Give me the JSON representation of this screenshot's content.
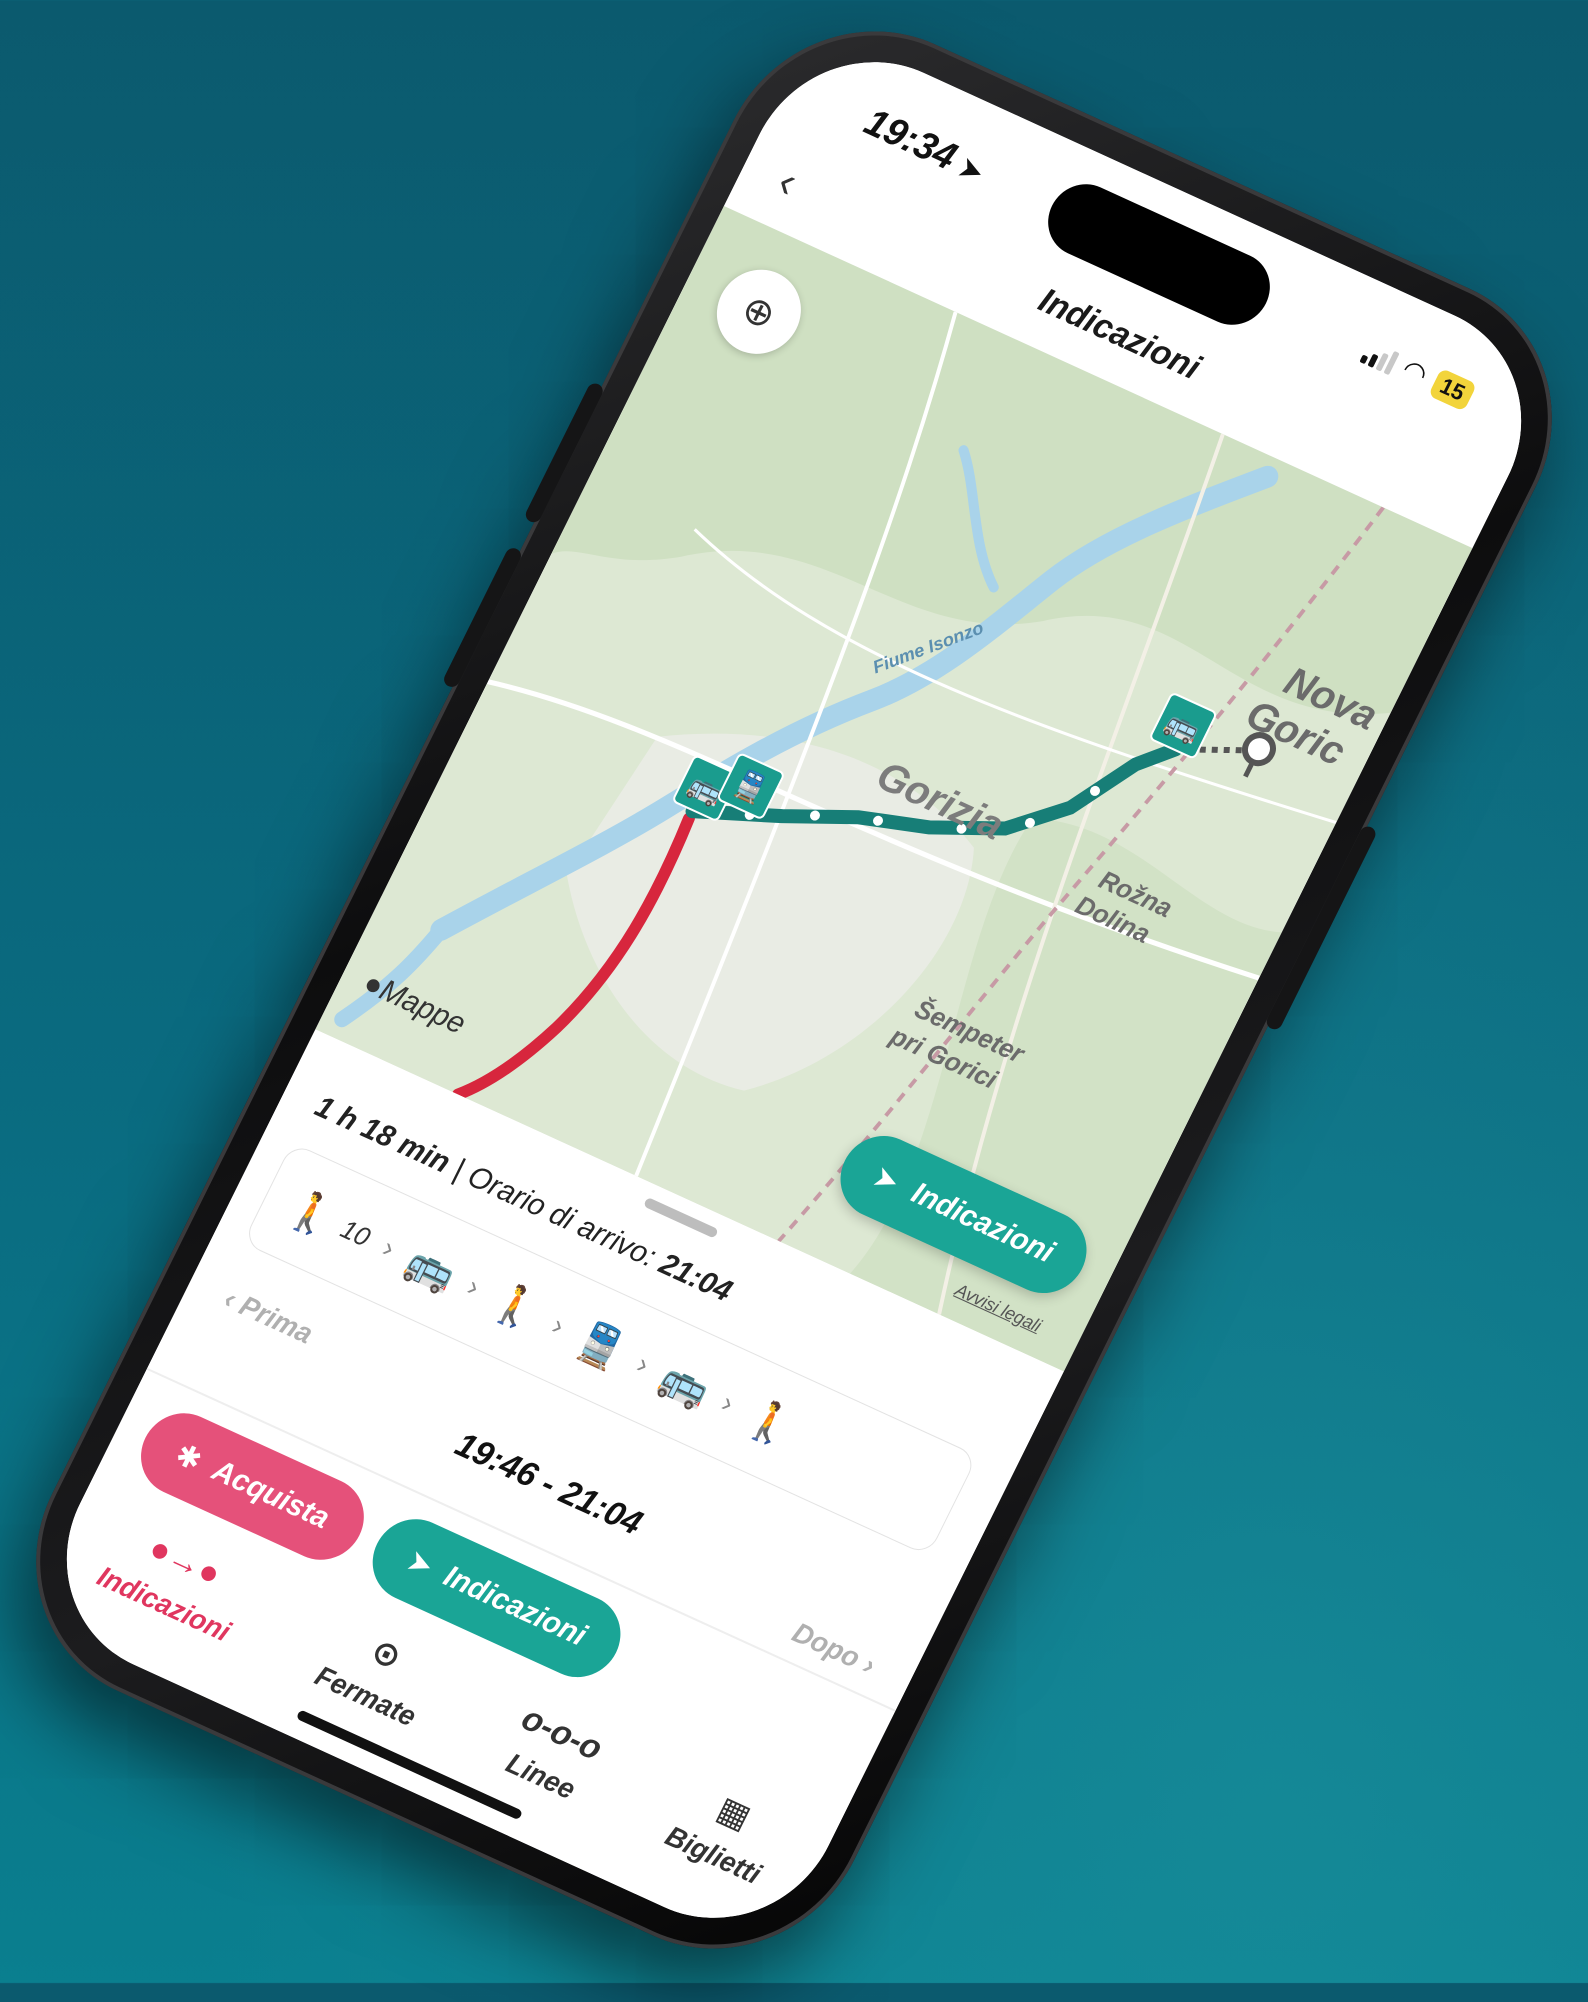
{
  "status": {
    "time": "19:34",
    "battery": "15"
  },
  "nav": {
    "back_icon": "‹",
    "title": "Indicazioni"
  },
  "map": {
    "labels": {
      "river": "Fiume Isonzo",
      "city": "Gorizia",
      "nova": "Nova",
      "gorica": "Goric",
      "rozna": "Rožna",
      "dolina": "Dolina",
      "sempeter": "Šempeter",
      "pri_gorici": "pri Gorici"
    },
    "attribution": "Mappe",
    "legal": "Avvisi legali",
    "directions_button": "Indicazioni",
    "colors": {
      "route_transit": "#177e77",
      "route_red": "#d7263d",
      "water": "#a9d3ea"
    }
  },
  "trip": {
    "duration": "1 h 18 min",
    "separator": "|",
    "arrival_label": "Orario di arrivo:",
    "arrival_time": "21:04",
    "walk_minutes": "10",
    "steps": [
      "walk",
      "bus",
      "walk",
      "train",
      "bus",
      "walk"
    ],
    "prev": "Prima",
    "range": "19:46 - 21:04",
    "next": "Dopo"
  },
  "actions": {
    "buy": "Acquista",
    "directions": "Indicazioni"
  },
  "tabs": [
    {
      "label": "Indicazioni",
      "icon": "route-icon",
      "active": true
    },
    {
      "label": "Fermate",
      "icon": "pin-icon",
      "active": false
    },
    {
      "label": "Linee",
      "icon": "lines-icon",
      "active": false
    },
    {
      "label": "Biglietti",
      "icon": "qr-icon",
      "active": false
    }
  ],
  "colors": {
    "accent_pink": "#e0365f",
    "accent_teal": "#1aa596",
    "background": "#0a6b80"
  }
}
